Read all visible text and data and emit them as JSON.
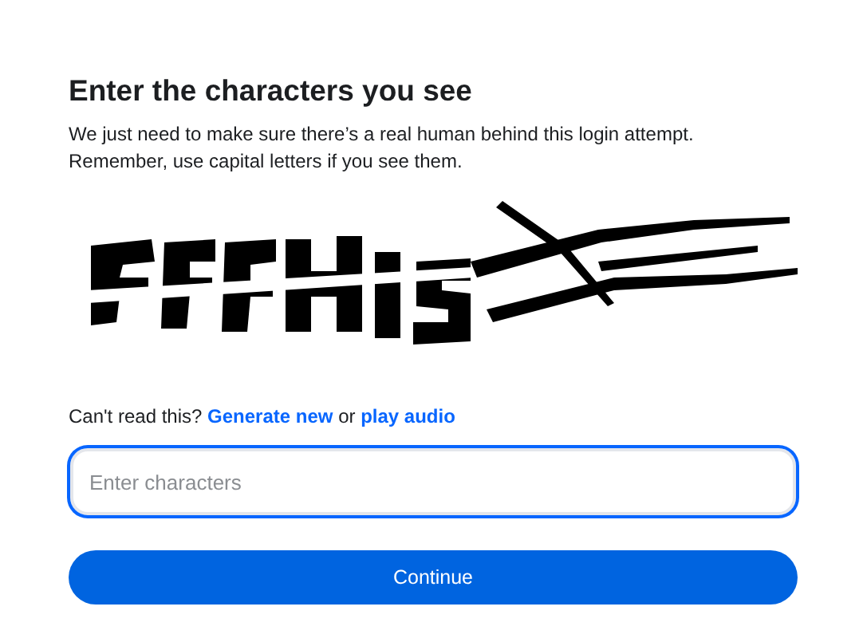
{
  "title": "Enter the characters you see",
  "description": [
    "We just need to make sure there’s a real human behind this login attempt.",
    "Remember, use capital letters if you see them."
  ],
  "help": {
    "text": "Can't read this?",
    "links": [
      {
        "label": "Generate new"
      },
      {
        "label": "play audio"
      }
    ],
    "joiner": "or"
  },
  "input": {
    "placeholder": "Enter characters",
    "focused": true
  },
  "button": {
    "label": "Continue"
  }
}
